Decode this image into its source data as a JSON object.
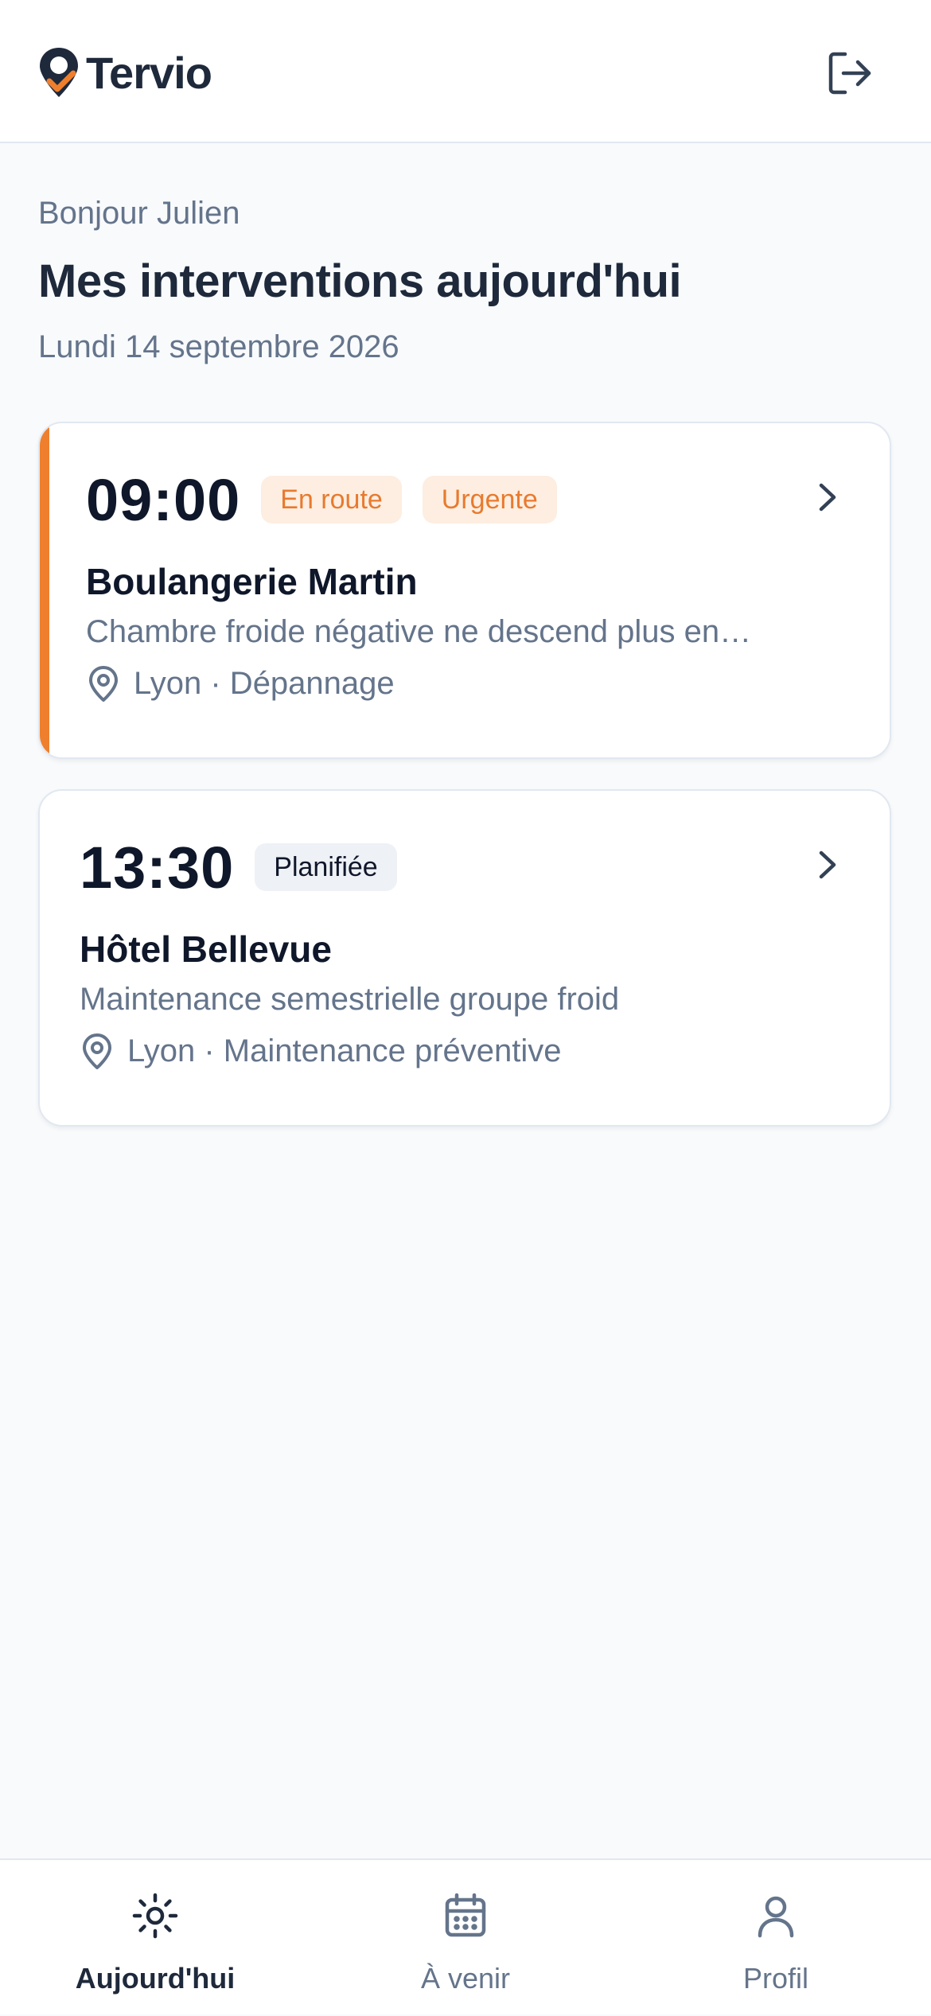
{
  "app": {
    "name": "Tervio"
  },
  "colors": {
    "accent": "#ef7f2d",
    "brand_dark": "#1e293b",
    "muted": "#64748b",
    "background": "#f8fafc"
  },
  "header": {
    "logo_icon": "map-pin-check-icon",
    "logout_icon": "logout-icon"
  },
  "page": {
    "greeting": "Bonjour Julien",
    "title": "Mes interventions aujourd'hui",
    "date": "Lundi 14 septembre 2026"
  },
  "interventions": [
    {
      "time": "09:00",
      "badges": [
        "En route",
        "Urgente"
      ],
      "client": "Boulangerie Martin",
      "description": "Chambre froide négative ne descend plus en…",
      "location": "Lyon · Dépannage",
      "urgent": true
    },
    {
      "time": "13:30",
      "badges": [
        "Planifiée"
      ],
      "client": "Hôtel Bellevue",
      "description": "Maintenance semestrielle groupe froid",
      "location": "Lyon · Maintenance préventive",
      "urgent": false
    }
  ],
  "nav": {
    "items": [
      {
        "label": "Aujourd'hui",
        "icon": "sun-icon",
        "active": true
      },
      {
        "label": "À venir",
        "icon": "calendar-icon",
        "active": false
      },
      {
        "label": "Profil",
        "icon": "user-icon",
        "active": false
      }
    ]
  }
}
